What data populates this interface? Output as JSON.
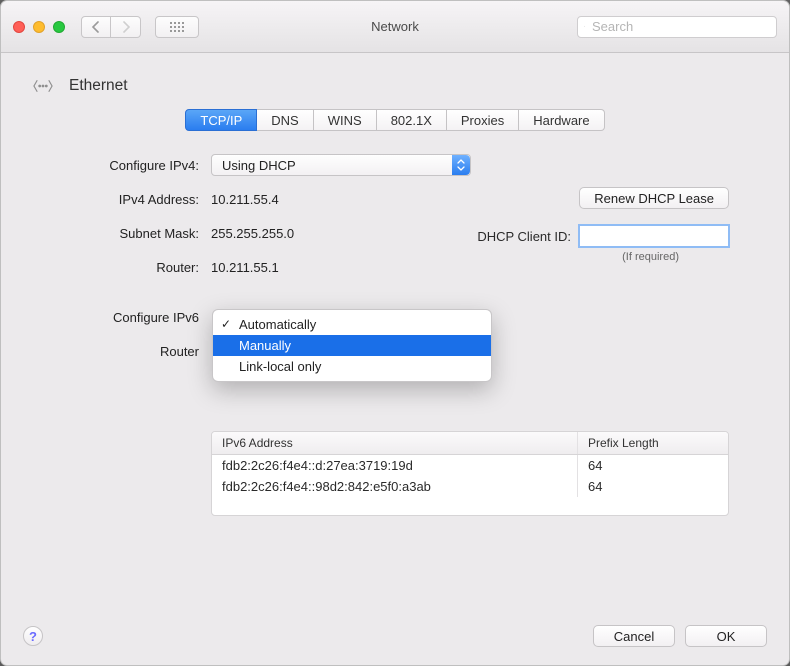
{
  "window": {
    "title": "Network"
  },
  "search": {
    "placeholder": "Search"
  },
  "page": {
    "title": "Ethernet"
  },
  "tabs": [
    "TCP/IP",
    "DNS",
    "WINS",
    "802.1X",
    "Proxies",
    "Hardware"
  ],
  "active_tab": "TCP/IP",
  "ipv4": {
    "configure_label": "Configure IPv4:",
    "configure_value": "Using DHCP",
    "address_label": "IPv4 Address:",
    "address_value": "10.211.55.4",
    "subnet_label": "Subnet Mask:",
    "subnet_value": "255.255.255.0",
    "router_label": "Router:",
    "router_value": "10.211.55.1",
    "renew_label": "Renew DHCP Lease",
    "client_id_label": "DHCP Client ID:",
    "client_id_value": "",
    "if_required": "(If required)"
  },
  "ipv6": {
    "configure_label": "Configure IPv6",
    "router_label": "Router",
    "menu": {
      "options": [
        "Automatically",
        "Manually",
        "Link-local only"
      ],
      "checked": "Automatically",
      "highlighted": "Manually"
    },
    "table": {
      "col_addr": "IPv6 Address",
      "col_plen": "Prefix Length",
      "rows": [
        {
          "addr": "fdb2:2c26:f4e4::d:27ea:3719:19d",
          "plen": "64"
        },
        {
          "addr": "fdb2:2c26:f4e4::98d2:842:e5f0:a3ab",
          "plen": "64"
        }
      ]
    }
  },
  "footer": {
    "cancel": "Cancel",
    "ok": "OK"
  }
}
